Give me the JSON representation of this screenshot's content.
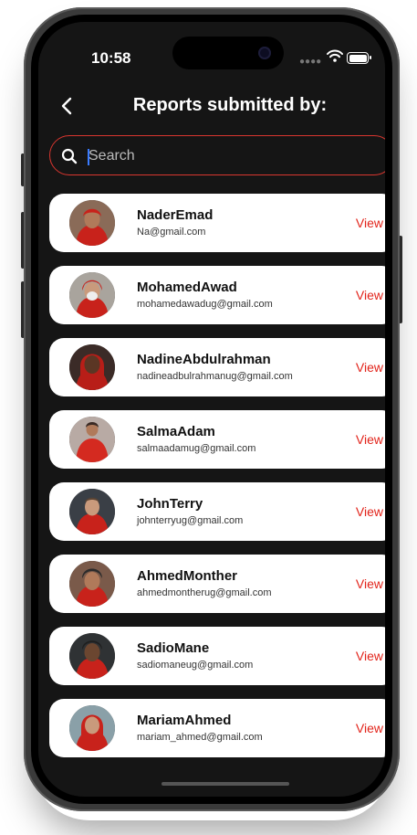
{
  "status_bar": {
    "time": "10:58",
    "icons": [
      "signal-dots-icon",
      "wifi-icon",
      "battery-icon"
    ]
  },
  "header": {
    "back_icon": "chevron-left-icon",
    "title": "Reports submitted by:"
  },
  "search": {
    "icon": "search-icon",
    "placeholder": "Search",
    "value": ""
  },
  "colors": {
    "screen_bg": "#151515",
    "accent": "#e2231a",
    "search_border": "#d9362f"
  },
  "reporters": [
    {
      "name": "NaderEmad",
      "email": "Na@gmail.com",
      "action": "View"
    },
    {
      "name": "MohamedAwad",
      "email": "mohamedawadug@gmail.com",
      "action": "View"
    },
    {
      "name": "NadineAbdulrahman",
      "email": "nadineadbulrahmanug@gmail.com",
      "action": "View"
    },
    {
      "name": "SalmaAdam",
      "email": "salmaadamug@gmail.com",
      "action": "View"
    },
    {
      "name": "JohnTerry",
      "email": "johnterryug@gmail.com",
      "action": "View"
    },
    {
      "name": "AhmedMonther",
      "email": "ahmedmontherug@gmail.com",
      "action": "View"
    },
    {
      "name": "SadioMane",
      "email": "sadiomaneug@gmail.com",
      "action": "View"
    },
    {
      "name": "MariamAhmed",
      "email": "mariam_ahmed@gmail.com",
      "action": "View"
    }
  ]
}
